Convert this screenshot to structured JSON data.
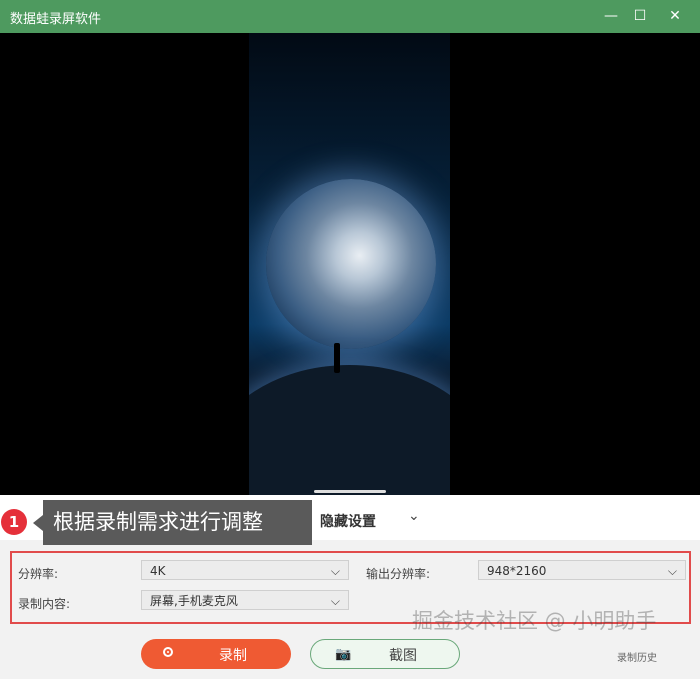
{
  "window": {
    "title": "数据蛙录屏软件",
    "minimize_glyph": "—",
    "maximize_glyph": "☐",
    "close_glyph": "✕"
  },
  "tabs": {
    "hidden_settings": "隐藏设置",
    "chevron": "⌄"
  },
  "settings": {
    "resolution_label": "分辨率:",
    "resolution_value": "4K",
    "output_resolution_label": "输出分辨率:",
    "output_resolution_value": "948*2160",
    "content_label": "录制内容:",
    "content_value": "屏幕,手机麦克风"
  },
  "buttons": {
    "record": "录制",
    "screenshot": "截图",
    "history": "录制历史"
  },
  "annotation": {
    "number": "1",
    "text": "根据录制需求进行调整"
  },
  "watermark": "掘金技术社区 @ 小明助手",
  "colors": {
    "titlebar": "#4e9a5f",
    "record_button": "#ef5a33",
    "highlight_border": "#e14b4b",
    "annotation_badge": "#e5303a"
  }
}
